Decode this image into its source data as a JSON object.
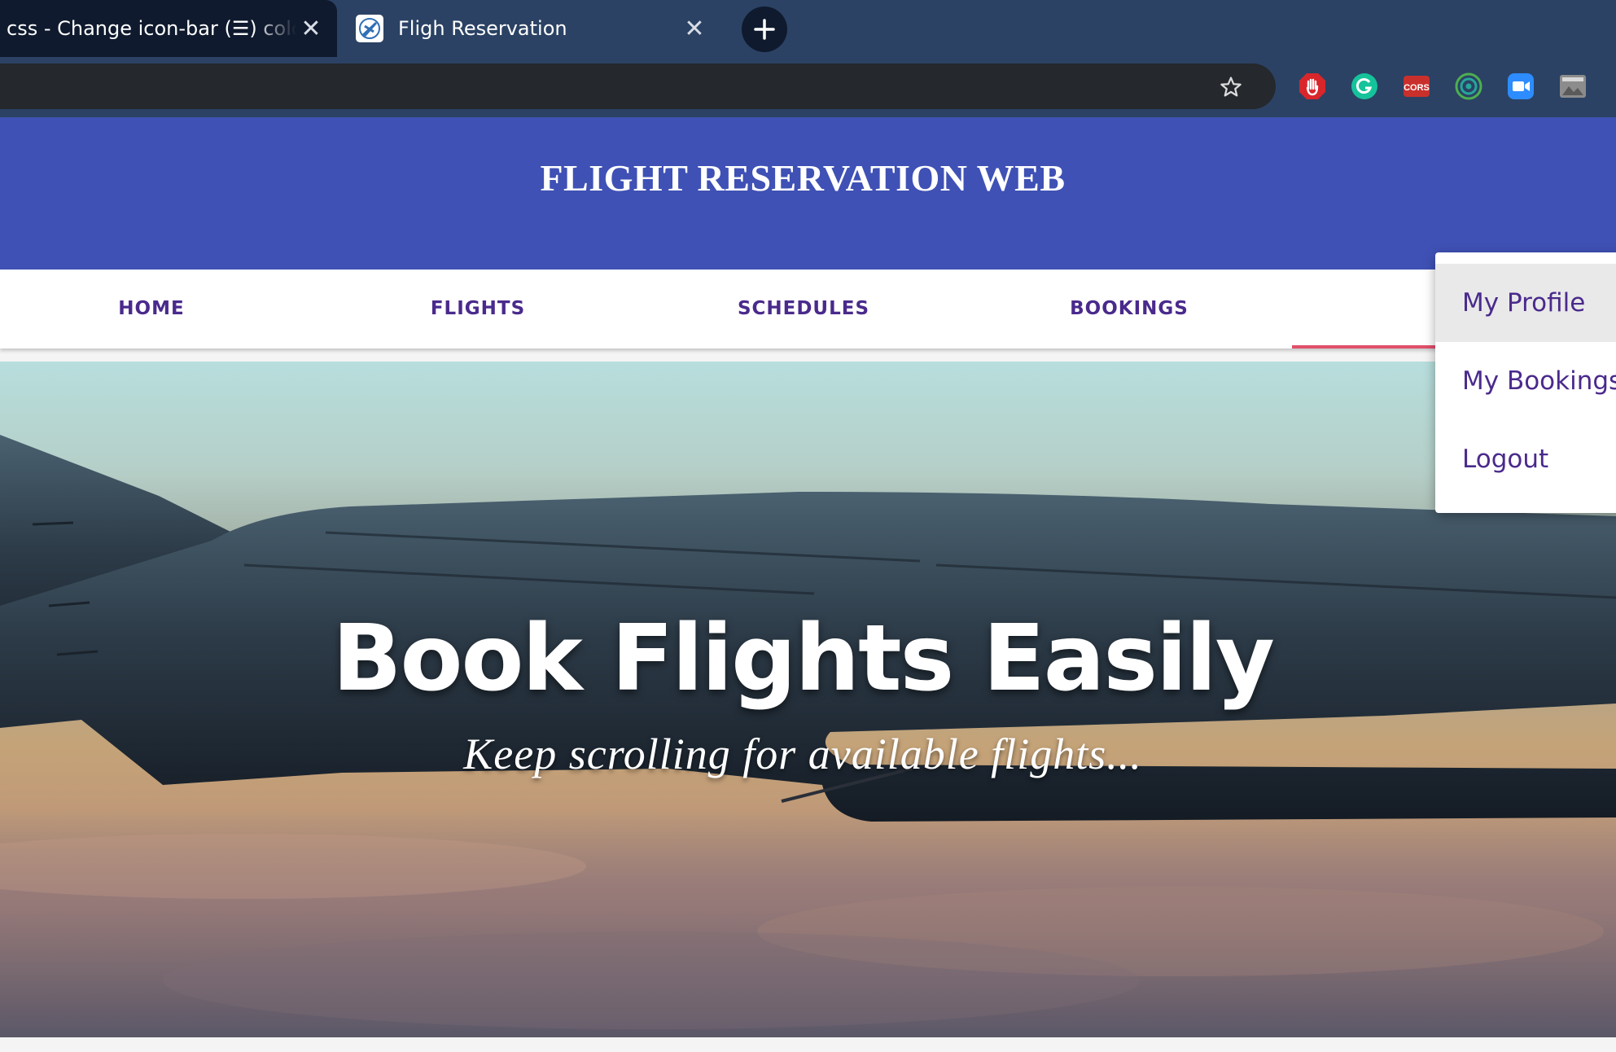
{
  "browser": {
    "tabs": [
      {
        "title": "css - Change icon-bar (☰) colo",
        "active": false
      },
      {
        "title": "Fligh Reservation",
        "active": true
      }
    ],
    "close_glyph": "✕",
    "new_tab_glyph": "+",
    "extensions": [
      "adblock-icon",
      "grammarly-icon",
      "cors-icon",
      "target-icon",
      "zoom-icon",
      "image-icon"
    ],
    "extension_cors_label": "CORS"
  },
  "header": {
    "title": "FLIGHT RESERVATION WEB",
    "background": "#3f51b5"
  },
  "nav": {
    "items": [
      "HOME",
      "FLIGHTS",
      "SCHEDULES",
      "BOOKINGS"
    ],
    "text_color": "#4a2a8c",
    "indicator_color": "#e0506a"
  },
  "hero": {
    "title": "Book Flights Easily",
    "subtitle": "Keep scrolling for available flights..."
  },
  "dropdown": {
    "items": [
      "My Profile",
      "My Bookings",
      "Logout"
    ],
    "highlighted": "My Profile"
  }
}
